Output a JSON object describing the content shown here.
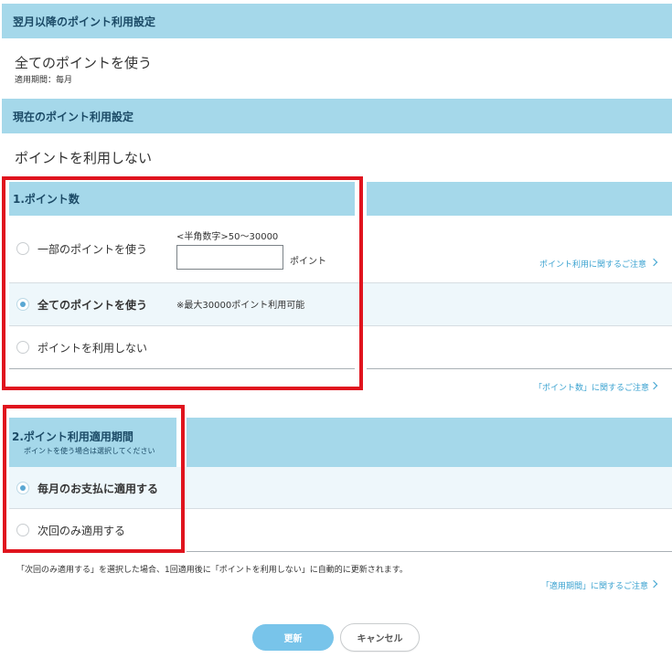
{
  "next_month_setting": {
    "header": "翌月以降のポイント利用設定",
    "value": "全てのポイントを使う",
    "period": "適用期間：毎月"
  },
  "current_setting": {
    "header": "現在のポイント利用設定",
    "value": "ポイントを利用しない"
  },
  "points_section": {
    "header": "1.ポイント数",
    "options": [
      {
        "label": "一部のポイントを使う",
        "checked": false
      },
      {
        "label": "全てのポイントを使う",
        "checked": true
      },
      {
        "label": "ポイントを利用しない",
        "checked": false
      }
    ],
    "input_hint": "<半角数字>50～30000",
    "input_value": "",
    "input_unit": "ポイント",
    "max_note": "※最大30000ポイント利用可能",
    "caution_link_1": "ポイント利用に関するご注意",
    "caution_link_2": "「ポイント数」に関するご注意"
  },
  "period_section": {
    "header": "2.ポイント利用適用期間",
    "subheader": "ポイントを使う場合は選択してください",
    "options": [
      {
        "label": "毎月のお支払に適用する",
        "checked": true
      },
      {
        "label": "次回のみ適用する",
        "checked": false
      }
    ],
    "note": "「次回のみ適用する」を選択した場合、1回適用後に「ポイントを利用しない」に自動的に更新されます。",
    "caution_link": "「適用期間」に関するご注意"
  },
  "buttons": {
    "update": "更新",
    "cancel": "キャンセル"
  },
  "colors": {
    "header_bg": "#a5d8ea",
    "highlight_box": "#e0141e",
    "link": "#3aa2d0",
    "primary_button": "#78c4ea"
  }
}
